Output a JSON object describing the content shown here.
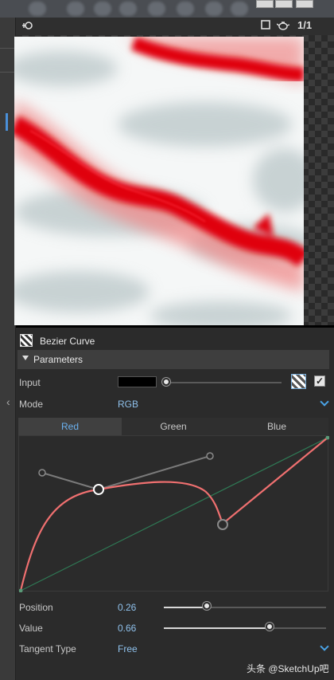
{
  "viewer": {
    "pagination": "1/1"
  },
  "panel": {
    "node_title": "Bezier Curve",
    "section_title": "Parameters",
    "input_label": "Input",
    "input_color": "#000000",
    "mode_label": "Mode",
    "mode_value": "RGB",
    "tabs": [
      "Red",
      "Green",
      "Blue"
    ],
    "active_tab": "Red",
    "position_label": "Position",
    "position_value": "0.26",
    "value_label": "Value",
    "value_value": "0.66",
    "tangent_label": "Tangent Type",
    "tangent_value": "Free"
  },
  "colors": {
    "accent": "#6ab0ee",
    "curve": "#f07070",
    "texture_red": "#e00010"
  },
  "watermark": "头条 @SketchUp吧"
}
